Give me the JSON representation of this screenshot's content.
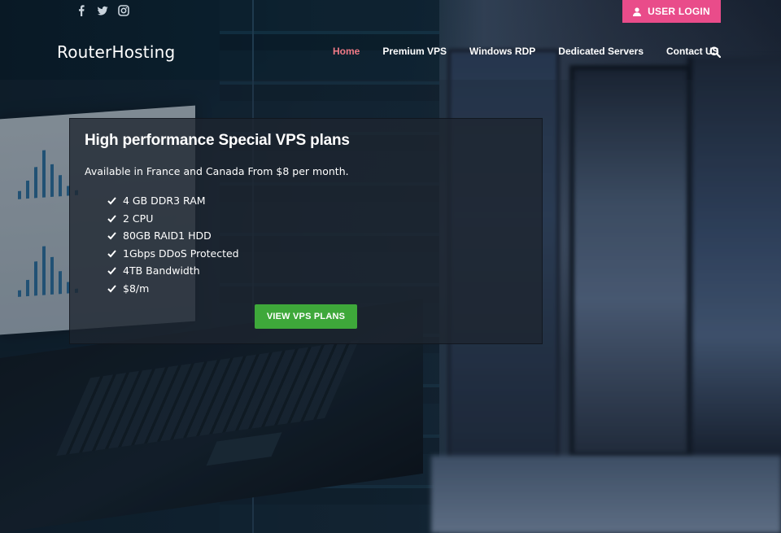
{
  "topbar": {
    "social_icons": [
      "facebook-icon",
      "twitter-icon",
      "instagram-icon"
    ],
    "login_icon": "user-icon",
    "login_label": "USER LOGIN"
  },
  "navbar": {
    "brand": "RouterHosting",
    "items": [
      {
        "label": "Home",
        "active": true
      },
      {
        "label": "Premium VPS",
        "active": false
      },
      {
        "label": "Windows RDP",
        "active": false
      },
      {
        "label": "Dedicated Servers",
        "active": false
      },
      {
        "label": "Contact US",
        "active": false
      }
    ],
    "search_icon": "search-icon"
  },
  "hero": {
    "title": "High performance Special VPS plans",
    "subtitle": "Available in France and Canada From $8 per month.",
    "features": [
      "4 GB DDR3 RAM",
      "2 CPU",
      "80GB RAID1 HDD",
      "1Gbps DDoS Protected",
      "4TB Bandwidth",
      "$8/m"
    ],
    "cta_label": "VIEW VPS PLANS"
  },
  "colors": {
    "login_button": "#e94c8a",
    "active_nav": "#f07a86",
    "cta_button": "#3ea83a"
  }
}
